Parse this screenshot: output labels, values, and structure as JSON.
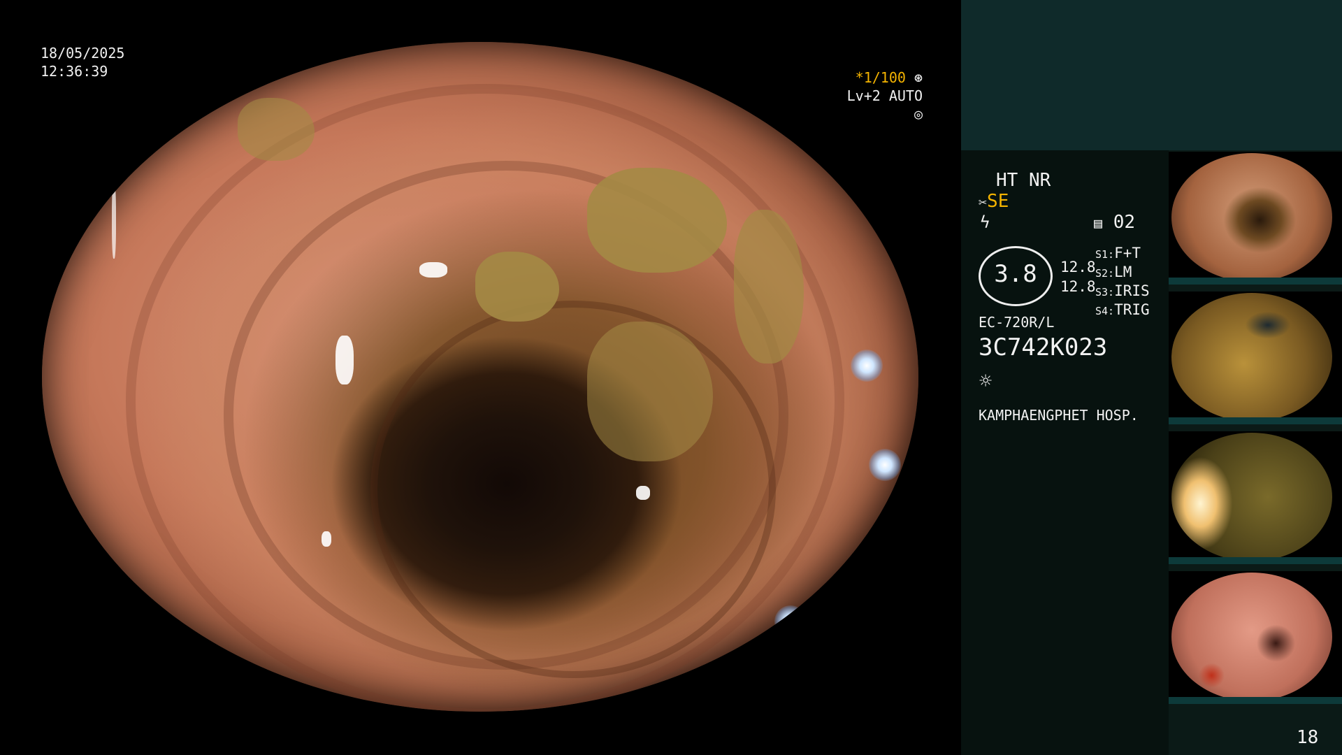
{
  "overlay": {
    "date": "18/05/2025",
    "time": "12:36:39",
    "shutter": "*1/100",
    "level": "Lv+2 AUTO"
  },
  "panel": {
    "ht_nr": "HT NR",
    "se": "SE",
    "memo": "02",
    "zoom_value": "3.8",
    "value_a": "12.8",
    "value_b": "12.8",
    "s1": "S1:",
    "s1_val": "F+T",
    "s2": "S2:",
    "s2_val": "LM",
    "s3": "S3:",
    "s3_val": "IRIS",
    "s4": "S4:",
    "s4_val": "TRIG",
    "scope_model": "EC-720R/L",
    "serial": "3C742K023",
    "hospital": "KAMPHAENGPHET HOSP."
  },
  "page_number": "18",
  "icons": [
    "aperture-icon",
    "auto-exposure-icon",
    "scissors-icon",
    "lightning-icon",
    "memo-icon",
    "light-source-icon"
  ],
  "colors": {
    "accent_yellow": "#f5b400",
    "panel_dark": "#07120f",
    "panel_teal": "#0f2a2a"
  }
}
